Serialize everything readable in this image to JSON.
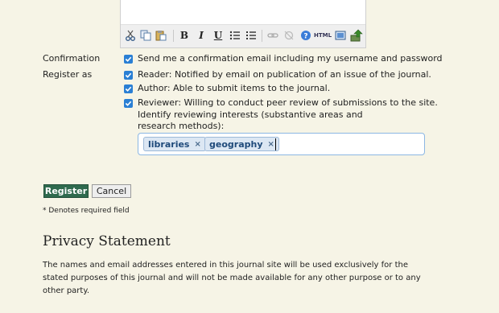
{
  "editor": {
    "toolbar": [
      {
        "icon": "cut-icon"
      },
      {
        "icon": "copy-icon"
      },
      {
        "icon": "paste-icon"
      },
      {
        "icon": "bold-icon",
        "glyph": "B"
      },
      {
        "icon": "italic-icon",
        "glyph": "I"
      },
      {
        "icon": "underline-icon",
        "glyph": "U"
      },
      {
        "icon": "bullet-list-icon"
      },
      {
        "icon": "numbered-list-icon"
      },
      {
        "icon": "link-icon"
      },
      {
        "icon": "unlink-icon"
      },
      {
        "icon": "help-icon"
      },
      {
        "icon": "html-icon",
        "glyph": "HTML"
      },
      {
        "icon": "fullscreen-icon"
      },
      {
        "icon": "upload-image-icon"
      }
    ]
  },
  "form": {
    "confirmation_label": "Confirmation",
    "confirmation_text": "Send me a confirmation email including my username and password",
    "register_as_label": "Register as",
    "reader_text": "Reader: Notified by email on publication of an issue of the journal.",
    "author_text": "Author: Able to submit items to the journal.",
    "reviewer_text": "Reviewer: Willing to conduct peer review of submissions to the site.",
    "interests_text": "Identify reviewing interests (substantive areas and research methods):",
    "tags": [
      "libraries",
      "geography"
    ],
    "tag_remove_glyph": "×",
    "register_button": "Register",
    "cancel_button": "Cancel",
    "required_note": "* Denotes required field"
  },
  "privacy": {
    "heading": "Privacy Statement",
    "text": "The names and email addresses entered in this journal site will be used exclusively for the stated purposes of this journal and will not be made available for any other purpose or to any other party."
  },
  "colors": {
    "background": "#f6f4e6",
    "checkbox": "#2a7fd4",
    "register_button": "#2f6a4e",
    "tag_bg": "#dce7f3"
  }
}
